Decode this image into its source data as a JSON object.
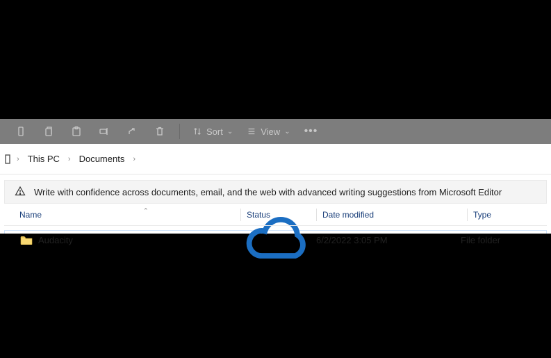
{
  "toolbar": {
    "sort_label": "Sort",
    "view_label": "View"
  },
  "breadcrumb": {
    "items": [
      "This PC",
      "Documents"
    ]
  },
  "banner": {
    "text": "Write with confidence across documents, email, and the web with advanced writing suggestions from Microsoft Editor"
  },
  "columns": {
    "name": "Name",
    "status": "Status",
    "date": "Date modified",
    "type": "Type"
  },
  "rows": [
    {
      "name": "Audacity",
      "status_icon": "cloud",
      "date": "6/2/2022 3:05 PM",
      "type": "File folder"
    }
  ]
}
